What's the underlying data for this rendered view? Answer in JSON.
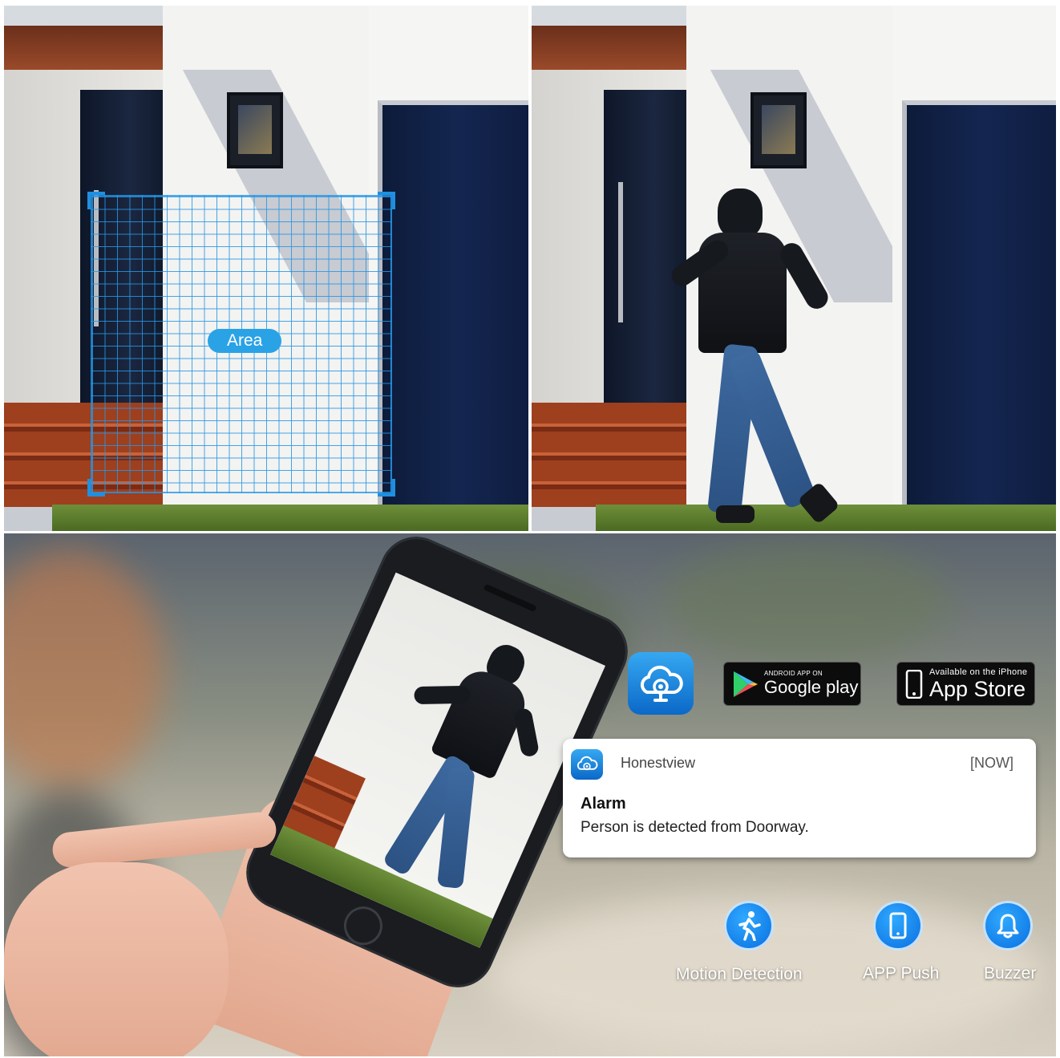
{
  "panels": {
    "top_left": {
      "overlay_label": "Area"
    },
    "top_right": {},
    "bottom": {
      "store_badges": {
        "google_play": {
          "small_text": "ANDROID APP ON",
          "big_text": "Google play"
        },
        "app_store": {
          "small_text": "Available on the iPhone",
          "big_text": "App Store"
        }
      },
      "notification": {
        "app_name": "Honestview",
        "time": "[NOW]",
        "title": "Alarm",
        "message": "Person is detected from Doorway."
      },
      "features": [
        {
          "label": "Motion Detection",
          "icon": "running-person-icon"
        },
        {
          "label": "APP Push",
          "icon": "phone-icon"
        },
        {
          "label": "Buzzer",
          "icon": "bell-icon"
        }
      ]
    }
  },
  "colors": {
    "accent_blue": "#1e90e0",
    "notification_bg": "#ffffff"
  }
}
